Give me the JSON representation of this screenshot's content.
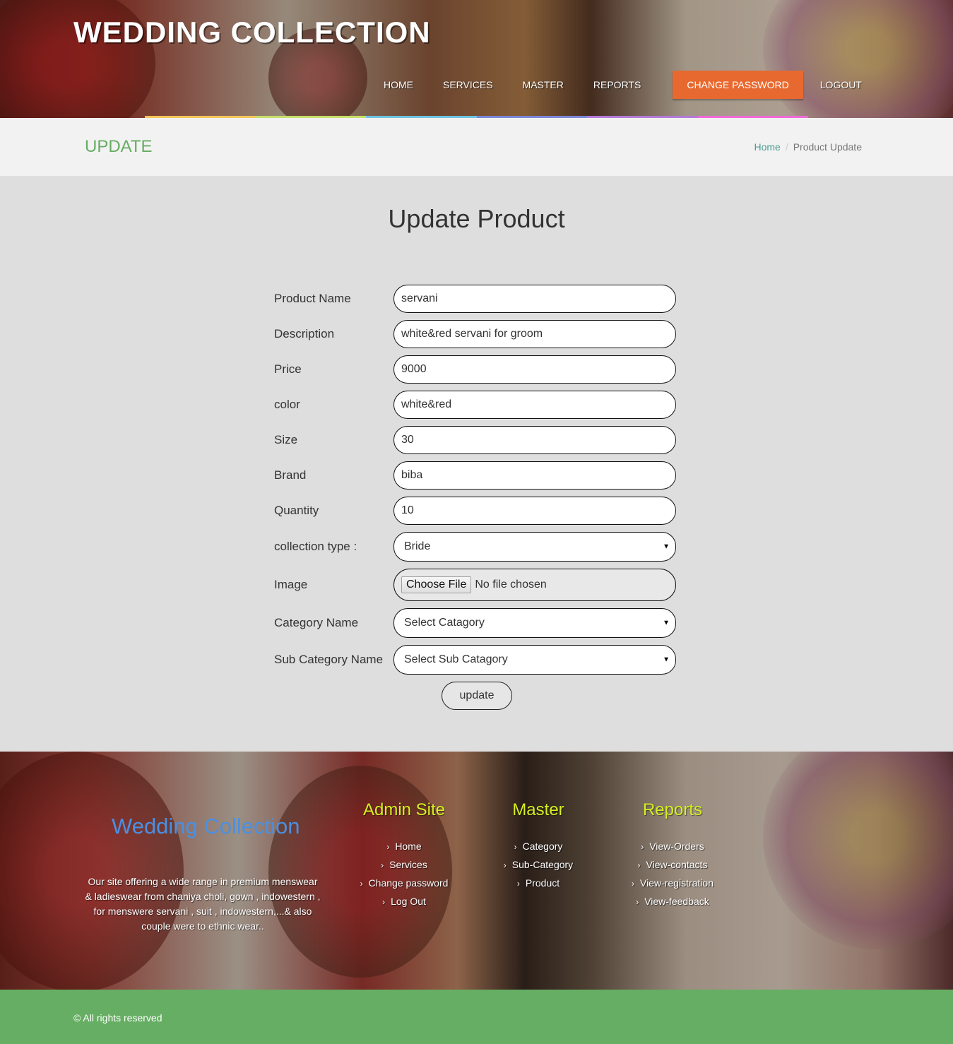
{
  "header": {
    "logo": "WEDDING COLLECTION",
    "nav": [
      "HOME",
      "SERVICES",
      "MASTER",
      "REPORTS",
      "CHANGE PASSWORD",
      "LOGOUT"
    ],
    "active_nav": "CHANGE PASSWORD",
    "colorbar": [
      "#f4c65a",
      "#c7de6a",
      "#6ec3e0",
      "#7c87d8",
      "#b57ad8",
      "#f06ad8"
    ]
  },
  "page": {
    "title": "UPDATE",
    "breadcrumb": {
      "home": "Home",
      "current": "Product Update"
    }
  },
  "form": {
    "heading": "Update Product",
    "fields": [
      {
        "label": "Product Name",
        "value": "servani"
      },
      {
        "label": "Description",
        "value": "white&red servani for groom"
      },
      {
        "label": "Price",
        "value": "9000"
      },
      {
        "label": "color",
        "value": "white&red"
      },
      {
        "label": "Size",
        "value": "30"
      },
      {
        "label": "Brand",
        "value": "biba"
      },
      {
        "label": "Quantity",
        "value": "10"
      }
    ],
    "collection_type": {
      "label": "collection type :",
      "value": "Bride"
    },
    "image": {
      "label": "Image",
      "button": "Choose File",
      "status": "No file chosen"
    },
    "category": {
      "label": "Category Name",
      "value": "Select Catagory"
    },
    "subcategory": {
      "label": "Sub Category Name",
      "value": "Select Sub Catagory"
    },
    "submit": "update"
  },
  "footer": {
    "brand": "Wedding Collection",
    "about": "Our site offering a wide range in premium menswear & ladieswear from chaniya choli, gown , indowestern , for menswere servani , suit , indowestern,...& also couple were to ethnic wear..",
    "admin": {
      "title": "Admin Site",
      "links": [
        "Home",
        "Services",
        "Change password",
        "Log Out"
      ]
    },
    "master": {
      "title": "Master",
      "links": [
        "Category",
        "Sub-Category",
        "Product"
      ]
    },
    "reports": {
      "title": "Reports",
      "links": [
        "View-Orders",
        "View-contacts",
        "View-registration",
        "View-feedback"
      ]
    },
    "copyright": "© All rights reserved"
  }
}
